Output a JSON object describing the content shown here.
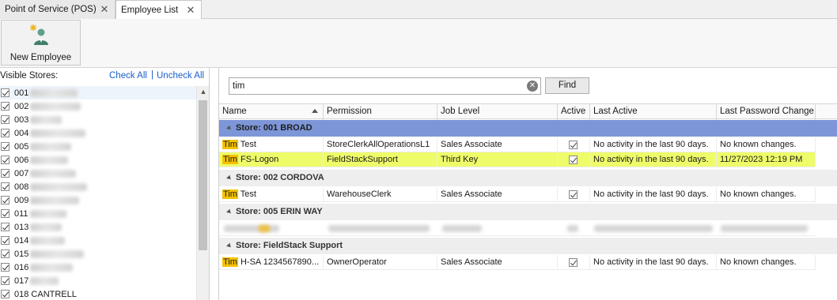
{
  "tabs": [
    {
      "label": "Point of Service (POS)",
      "close": "✕"
    },
    {
      "label": "Employee List",
      "close": "✕"
    }
  ],
  "ribbon": {
    "new_employee_label": "New Employee"
  },
  "left_panel": {
    "title": "Visible Stores:",
    "check_all": "Check All",
    "separator": "|",
    "uncheck_all": "Uncheck All",
    "stores": [
      "001",
      "002",
      "003",
      "004",
      "005",
      "006",
      "007",
      "008",
      "009",
      "011",
      "013",
      "014",
      "015",
      "016",
      "017",
      "018 CANTRELL"
    ]
  },
  "search": {
    "value": "tim",
    "find_label": "Find"
  },
  "grid": {
    "columns": [
      "Name",
      "Permission",
      "Job Level",
      "Active",
      "Last Active",
      "Last Password Change"
    ],
    "groups": [
      {
        "label": "Store: 001 BROAD",
        "rows": [
          {
            "name_hit": "Tim",
            "name_rest": " Test",
            "permission": "StoreClerkAllOperationsL1",
            "job_level": "Sales Associate",
            "last_active": "No activity in the last 90 days.",
            "last_pw": "No known changes."
          },
          {
            "name_hit": "Tim",
            "name_rest": " FS-Logon",
            "permission": "FieldStackSupport",
            "job_level": "Third Key",
            "last_active": "No activity in the last 90 days.",
            "last_pw": "11/27/2023 12:19 PM"
          }
        ]
      },
      {
        "label": "Store: 002 CORDOVA",
        "rows": [
          {
            "name_hit": "Tim",
            "name_rest": " Test",
            "permission": "WarehouseClerk",
            "job_level": "Sales Associate",
            "last_active": "No activity in the last 90 days.",
            "last_pw": "No known changes."
          }
        ]
      },
      {
        "label": "Store: 005 ERIN WAY",
        "rows": []
      },
      {
        "label": "Store: FieldStack Support",
        "rows": [
          {
            "name_hit": "Tim",
            "name_rest": " H-SA 1234567890...",
            "permission": "OwnerOperator",
            "job_level": "Sales Associate",
            "last_active": "No activity in the last 90 days.",
            "last_pw": "No known changes."
          }
        ]
      }
    ]
  },
  "colors": {
    "group_active": "#7d96d8",
    "highlight_row": "#eefc6a",
    "search_hit": "#f4c200",
    "link": "#1c5dc9"
  }
}
